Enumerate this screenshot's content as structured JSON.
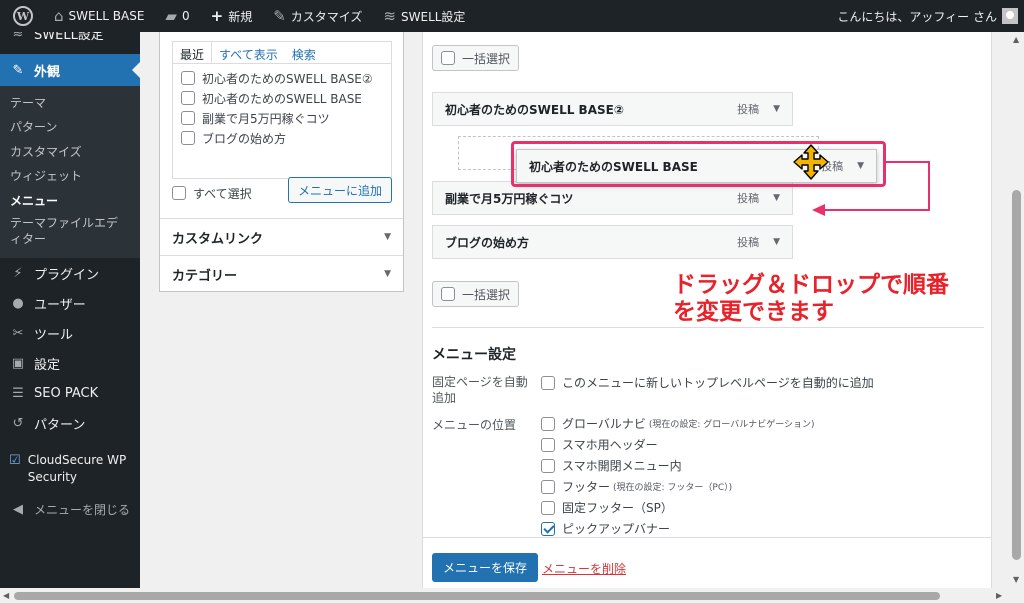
{
  "admin_bar": {
    "site_name": "SWELL BASE",
    "comments_count": "0",
    "new_label": "新規",
    "customize_label": "カスタマイズ",
    "swell_settings_label": "SWELL設定",
    "greeting": "こんにちは、アッフィー さん"
  },
  "sidebar": {
    "items": [
      {
        "label": "SWELL設定",
        "icon": "swell-icon"
      },
      {
        "label": "外観",
        "icon": "paintbrush-icon"
      },
      {
        "label": "プラグイン",
        "icon": "plugin-icon"
      },
      {
        "label": "ユーザー",
        "icon": "user-icon"
      },
      {
        "label": "ツール",
        "icon": "wrench-icon"
      },
      {
        "label": "設定",
        "icon": "settings-icon"
      },
      {
        "label": "SEO PACK",
        "icon": "list-icon"
      },
      {
        "label": "パターン",
        "icon": "undo-icon"
      },
      {
        "label": "CloudSecure WP Security",
        "icon": "shield-check-icon"
      },
      {
        "label": "メニューを閉じる",
        "icon": "collapse-icon"
      }
    ],
    "submenu": [
      "テーマ",
      "パターン",
      "カスタマイズ",
      "ウィジェット",
      "メニュー",
      "テーマファイルエディター"
    ]
  },
  "left_panel": {
    "tabs": [
      "最近",
      "すべて表示",
      "検索"
    ],
    "items": [
      "初心者のためのSWELL BASE②",
      "初心者のためのSWELL BASE",
      "副業で月5万円稼ぐコツ",
      "ブログの始め方"
    ],
    "select_all": "すべて選択",
    "add_button": "メニューに追加",
    "accordions": [
      "カスタムリンク",
      "カテゴリー"
    ]
  },
  "menu_structure": {
    "bulk_select": "一括選択",
    "item_type": "投稿",
    "items": [
      "初心者のためのSWELL BASE②",
      "副業で月5万円稼ぐコツ",
      "ブログの始め方"
    ],
    "dragging_item": "初心者のためのSWELL BASE",
    "annotation": [
      "ドラッグ＆ドロップで順番",
      "を変更できます"
    ]
  },
  "menu_settings": {
    "title": "メニュー設定",
    "auto_add_label": "固定ページを自動追加",
    "auto_add_option": "このメニューに新しいトップレベルページを自動的に追加",
    "location_label": "メニューの位置",
    "locations": [
      {
        "label": "グローバルナビ",
        "note": "(現在の設定: グローバルナビゲーション)",
        "checked": false
      },
      {
        "label": "スマホ用ヘッダー",
        "note": "",
        "checked": false
      },
      {
        "label": "スマホ開閉メニュー内",
        "note": "",
        "checked": false
      },
      {
        "label": "フッター",
        "note": "(現在の設定: フッター（PC）)",
        "checked": false
      },
      {
        "label": "固定フッター（SP）",
        "note": "",
        "checked": false
      },
      {
        "label": "ピックアップバナー",
        "note": "",
        "checked": true
      }
    ],
    "save_button": "メニューを保存",
    "delete_link": "メニューを削除"
  },
  "colors": {
    "accent": "#2271b1",
    "annotation": "#e8222a",
    "highlight": "#e8306a"
  }
}
